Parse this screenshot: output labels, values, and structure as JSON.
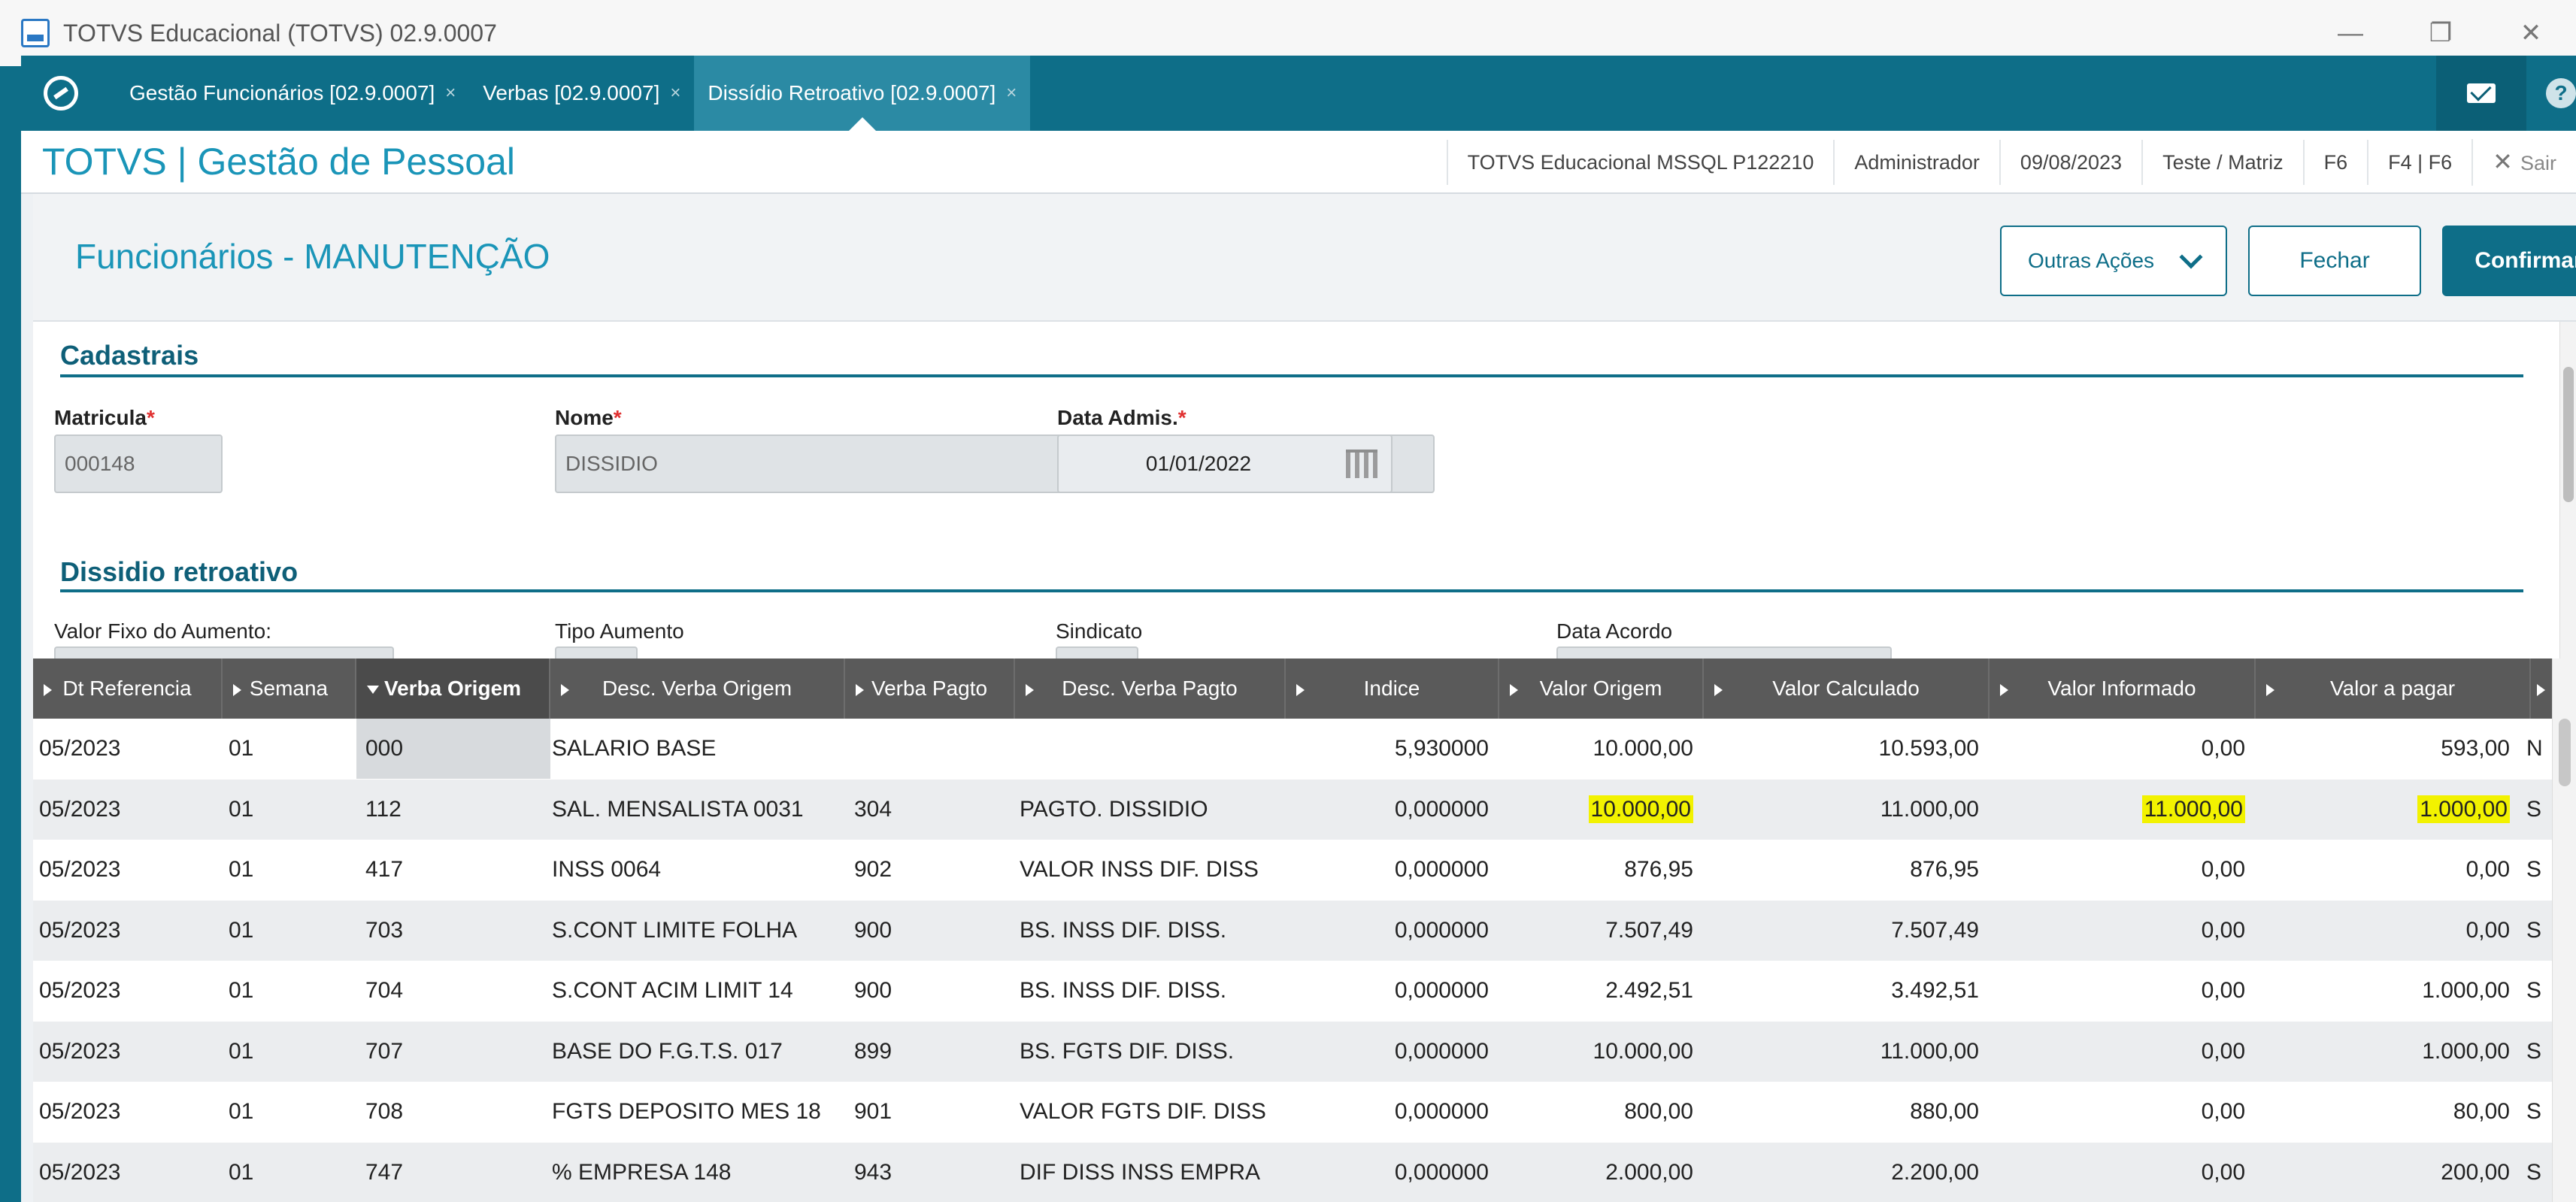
{
  "window": {
    "title": "TOTVS Educacional (TOTVS) 02.9.0007",
    "minimize": "—",
    "restore": "❐",
    "close": "✕"
  },
  "tabs": [
    {
      "label": "Gestão Funcionários [02.9.0007]",
      "close": "×"
    },
    {
      "label": "Verbas [02.9.0007]",
      "close": "×"
    },
    {
      "label": "Dissídio Retroativo [02.9.0007]",
      "close": "×"
    }
  ],
  "help_label": "?",
  "header": {
    "brand": "TOTVS | Gestão de Pessoal",
    "environment": "TOTVS Educacional MSSQL P122210",
    "user": "Administrador",
    "date": "09/08/2023",
    "branch": "Teste / Matriz",
    "f6": "F6",
    "f4f6": "F4 | F6",
    "sair_icon": "✕",
    "sair": "Sair"
  },
  "page": {
    "title": "Funcionários - MANUTENÇÃO",
    "outras_acoes": "Outras Ações",
    "fechar": "Fechar",
    "confirmar": "Confirmar"
  },
  "cadastrais": {
    "title": "Cadastrais",
    "matricula_label": "Matricula",
    "matricula_value": "000148",
    "nome_label": "Nome",
    "nome_value": "DISSIDIO",
    "data_label": "Data Admis.",
    "data_value": "01/01/2022",
    "required_mark": "*"
  },
  "dissidio": {
    "title": "Dissidio retroativo",
    "valor_fixo_label": "Valor Fixo do Aumento:",
    "tipo_label": "Tipo Aumento",
    "sindicato_label": "Sindicato",
    "data_acordo_label": "Data Acordo"
  },
  "grid": {
    "columns": [
      "Dt Referencia",
      "Semana",
      "Verba Origem",
      "Desc. Verba Origem",
      "Verba Pagto",
      "Desc. Verba Pagto",
      "Indice",
      "Valor Origem",
      "Valor Calculado",
      "Valor Informado",
      "Valor a pagar"
    ],
    "rows": [
      [
        "05/2023",
        "01",
        "000",
        "SALARIO BASE",
        "",
        "",
        "5,930000",
        "10.000,00",
        "10.593,00",
        "0,00",
        "593,00",
        "N"
      ],
      [
        "05/2023",
        "01",
        "112",
        "SAL. MENSALISTA 0031",
        "304",
        "PAGTO. DISSIDIO",
        "0,000000",
        "10.000,00",
        "11.000,00",
        "11.000,00",
        "1.000,00",
        "S"
      ],
      [
        "05/2023",
        "01",
        "417",
        "INSS 0064",
        "902",
        "VALOR INSS DIF. DISS",
        "0,000000",
        "876,95",
        "876,95",
        "0,00",
        "0,00",
        "S"
      ],
      [
        "05/2023",
        "01",
        "703",
        "S.CONT LIMITE FOLHA",
        "900",
        "BS. INSS DIF. DISS.",
        "0,000000",
        "7.507,49",
        "7.507,49",
        "0,00",
        "0,00",
        "S"
      ],
      [
        "05/2023",
        "01",
        "704",
        "S.CONT ACIM LIMIT 14",
        "900",
        "BS. INSS DIF. DISS.",
        "0,000000",
        "2.492,51",
        "3.492,51",
        "0,00",
        "1.000,00",
        "S"
      ],
      [
        "05/2023",
        "01",
        "707",
        "BASE DO F.G.T.S. 017",
        "899",
        "BS. FGTS DIF. DISS.",
        "0,000000",
        "10.000,00",
        "11.000,00",
        "0,00",
        "1.000,00",
        "S"
      ],
      [
        "05/2023",
        "01",
        "708",
        "FGTS DEPOSITO MES 18",
        "901",
        "VALOR FGTS DIF. DISS",
        "0,000000",
        "800,00",
        "880,00",
        "0,00",
        "80,00",
        "S"
      ],
      [
        "05/2023",
        "01",
        "747",
        "% EMPRESA  148",
        "943",
        "DIF DISS INSS EMPRA",
        "0,000000",
        "2.000,00",
        "2.200,00",
        "0,00",
        "200,00",
        "S"
      ]
    ]
  },
  "colors": {
    "teal": "#0e6e88",
    "brand": "#1a95b8",
    "highlight": "#f2f200"
  }
}
